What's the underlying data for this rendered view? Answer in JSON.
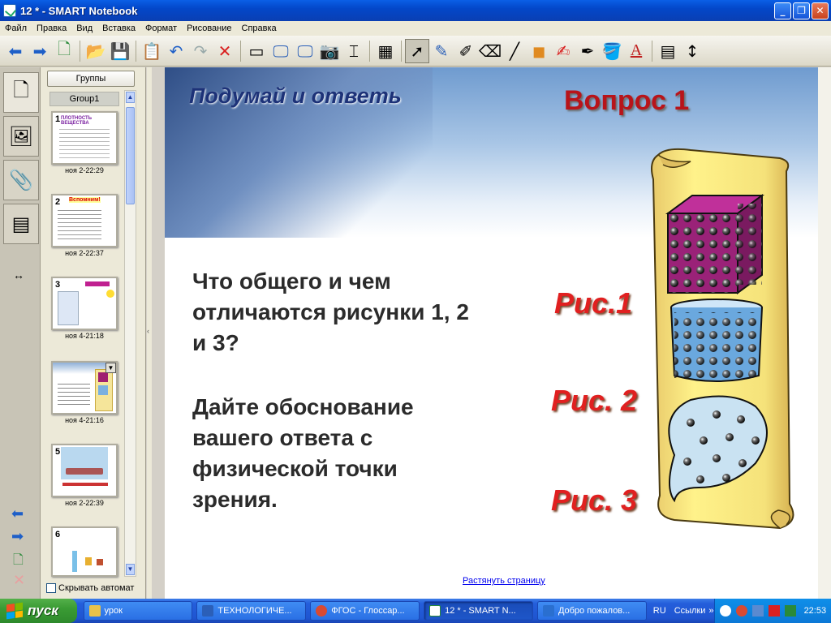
{
  "window": {
    "title": "12 * - SMART Notebook"
  },
  "menu": [
    "Файл",
    "Правка",
    "Вид",
    "Вставка",
    "Формат",
    "Рисование",
    "Справка"
  ],
  "sorter": {
    "groups_button": "Группы",
    "group_label": "Group1",
    "autohide_label": "Скрывать автомат",
    "pages": [
      {
        "num": "1",
        "timestamp": "ноя 2-22:29",
        "heading": "ПЛОТНОСТЬ ВЕЩЕСТВА"
      },
      {
        "num": "2",
        "timestamp": "ноя 2-22:37",
        "heading": "Вспомним!"
      },
      {
        "num": "3",
        "timestamp": "ноя 4-21:18",
        "heading": ""
      },
      {
        "num": "4",
        "timestamp": "ноя 4-21:16",
        "heading": ""
      },
      {
        "num": "5",
        "timestamp": "ноя 2-22:39",
        "heading": ""
      },
      {
        "num": "6",
        "timestamp": "",
        "heading": ""
      }
    ]
  },
  "slide": {
    "think_title": "Подумай и ответь",
    "question_title": "Вопрос 1",
    "question_line1": "Что общего и чем\nотличаются рисунки 1, 2\nи 3?",
    "question_line2": "Дайте обоснование\nвашего ответа с\nфизической точки\nзрения.",
    "fig1": "Рис.1",
    "fig2": "Рис. 2",
    "fig3": "Рис. 3",
    "stretch_link": "Растянуть страницу"
  },
  "taskbar": {
    "start": "пуск",
    "tasks": [
      {
        "label": "урок",
        "color": "#e8c34a"
      },
      {
        "label": "ТЕХНОЛОГИЧЕ...",
        "color": "#2b5fb8"
      },
      {
        "label": "ФГОС - Глоссар...",
        "color": "#d94a32"
      },
      {
        "label": "12 * - SMART N...",
        "color": "#2a8a3a"
      },
      {
        "label": "Добро пожалов...",
        "color": "#2a6fd0"
      }
    ],
    "lang": "RU",
    "links": "Ссылки",
    "clock": "22:53"
  },
  "colors": {
    "accent_red": "#b8141a",
    "fig_red": "#e02020",
    "title_blue": "#1d3278"
  }
}
